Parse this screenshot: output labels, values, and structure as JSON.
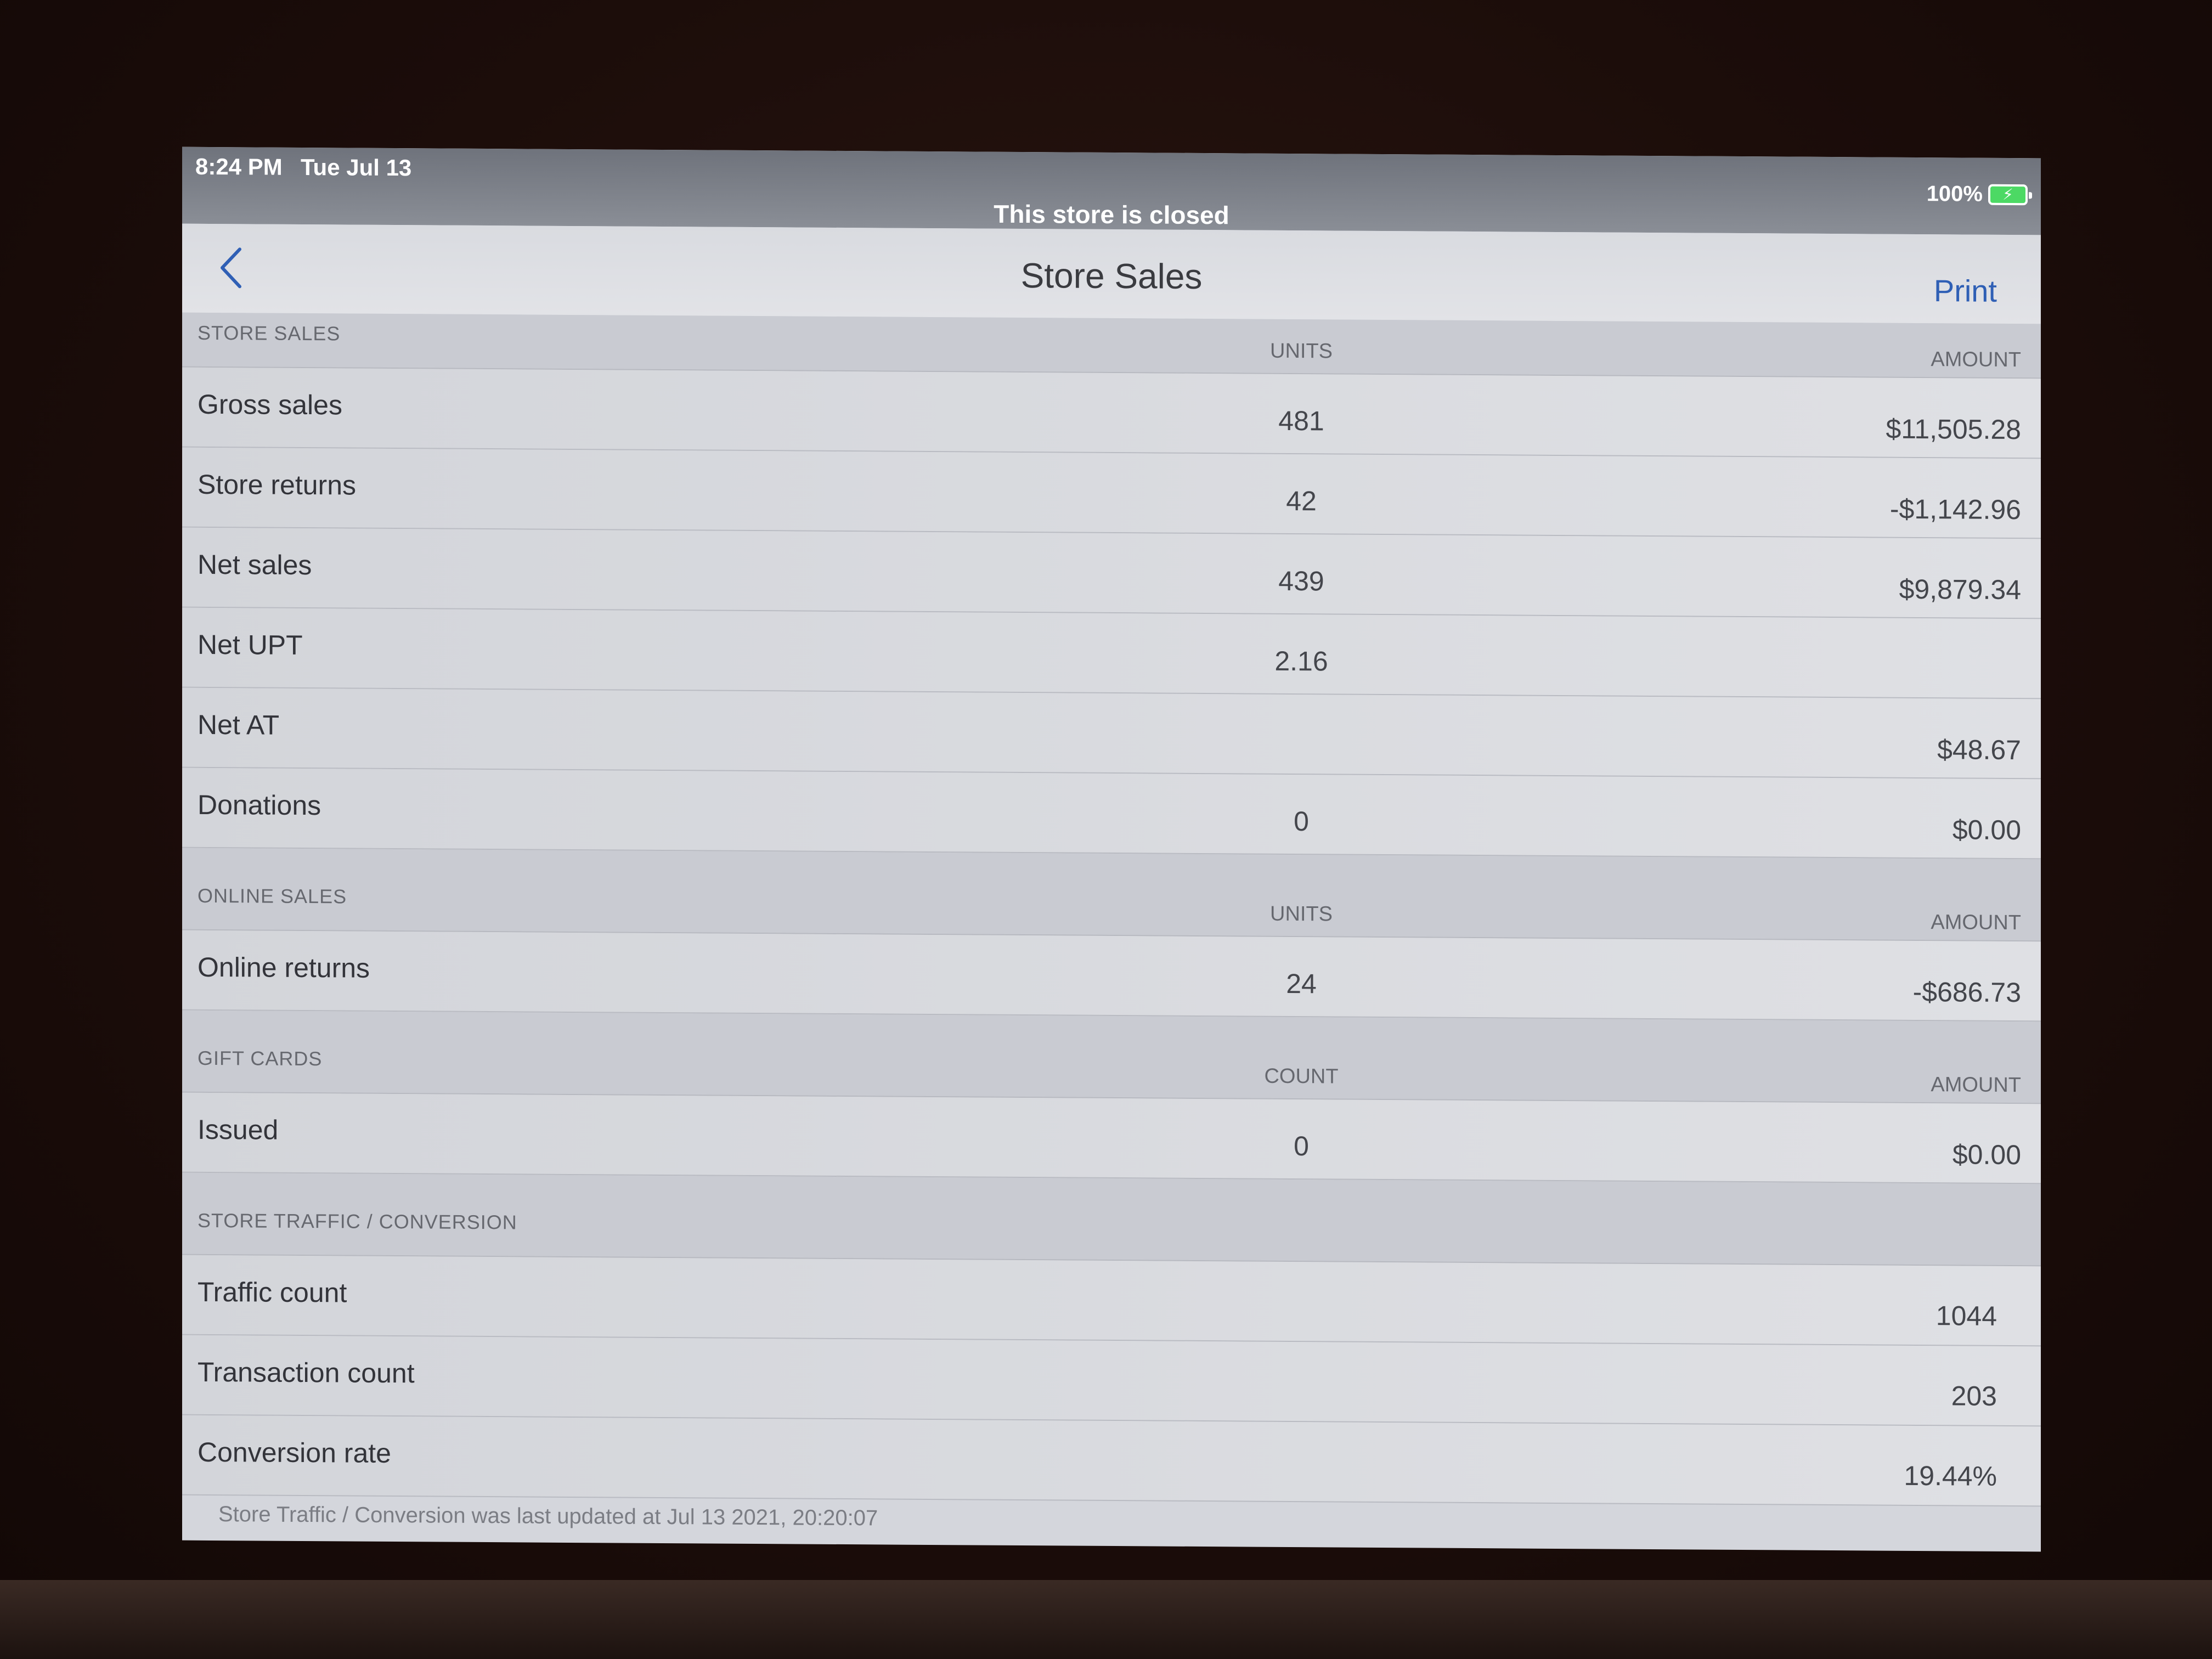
{
  "status_bar": {
    "time": "8:24 PM",
    "date": "Tue Jul 13",
    "battery": "100%",
    "banner": "This store is closed"
  },
  "nav": {
    "title": "Store Sales",
    "print_label": "Print"
  },
  "store_sales": {
    "title": "STORE SALES",
    "units_header": "UNITS",
    "amount_header": "AMOUNT",
    "rows": [
      {
        "label": "Gross sales",
        "units": "481",
        "amount": "$11,505.28"
      },
      {
        "label": "Store returns",
        "units": "42",
        "amount": "-$1,142.96"
      },
      {
        "label": "Net sales",
        "units": "439",
        "amount": "$9,879.34"
      },
      {
        "label": "Net UPT",
        "units": "2.16",
        "amount": ""
      },
      {
        "label": "Net AT",
        "units": "",
        "amount": "$48.67"
      },
      {
        "label": "Donations",
        "units": "0",
        "amount": "$0.00"
      }
    ]
  },
  "online_sales": {
    "title": "ONLINE SALES",
    "units_header": "UNITS",
    "amount_header": "AMOUNT",
    "rows": [
      {
        "label": "Online returns",
        "units": "24",
        "amount": "-$686.73"
      }
    ]
  },
  "gift_cards": {
    "title": "GIFT CARDS",
    "count_header": "COUNT",
    "amount_header": "AMOUNT",
    "rows": [
      {
        "label": "Issued",
        "count": "0",
        "amount": "$0.00"
      }
    ]
  },
  "traffic": {
    "title": "STORE TRAFFIC / CONVERSION",
    "rows": [
      {
        "label": "Traffic count",
        "value": "1044"
      },
      {
        "label": "Transaction count",
        "value": "203"
      },
      {
        "label": "Conversion rate",
        "value": "19.44%"
      }
    ],
    "footer": "Store Traffic / Conversion was last updated at Jul 13 2021, 20:20:07"
  },
  "colors": {
    "accent": "#2f5fb5",
    "battery": "#4cd964"
  },
  "icons": {
    "back": "chevron-left-icon",
    "battery": "battery-charging-icon"
  }
}
